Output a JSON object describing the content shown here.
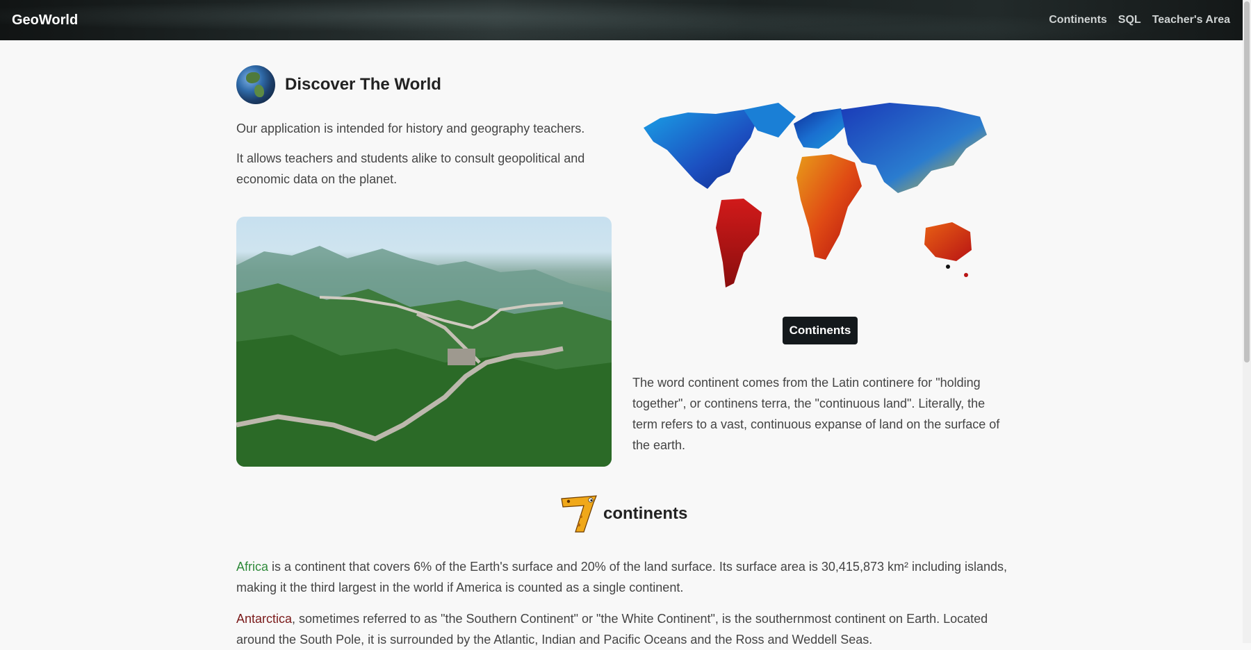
{
  "nav": {
    "brand": "GeoWorld",
    "links": [
      "Continents",
      "SQL",
      "Teacher's Area"
    ]
  },
  "intro": {
    "title": "Discover The World",
    "p1": "Our application is intended for history and geography teachers.",
    "p2": "It allows teachers and students alike to consult geopolitical and economic data on the planet."
  },
  "cta": {
    "continents_button": "Continents"
  },
  "definition": {
    "text": "The word continent comes from the Latin continere for \"holding together\", or continens terra, the \"continuous land\". Literally, the term refers to a vast, continuous expanse of land on the surface of the earth."
  },
  "section": {
    "title": "continents"
  },
  "africa": {
    "name": "Africa",
    "text": " is a continent that covers 6% of the Earth's surface and 20% of the land surface. Its surface area is 30,415,873 km² including islands, making it the third largest in the world if America is counted as a single continent."
  },
  "antarctica": {
    "name": "Antarctica",
    "text": ", sometimes referred to as \"the Southern Continent\" or \"the White Continent\", is the southernmost continent on Earth. Located around the South Pole, it is surrounded by the Atlantic, Indian and Pacific Oceans and the Ross and Weddell Seas."
  },
  "colors": {
    "navbar_bg": "#1d2424",
    "button_bg": "#14191c",
    "africa_link": "#2f8a3a",
    "antarctica_link": "#7a1a1a",
    "page_bg": "#f8f8f8"
  },
  "icons": {
    "globe": "globe-icon",
    "seven": "number-seven-icon",
    "map": "world-map-image",
    "wall": "great-wall-photo"
  }
}
